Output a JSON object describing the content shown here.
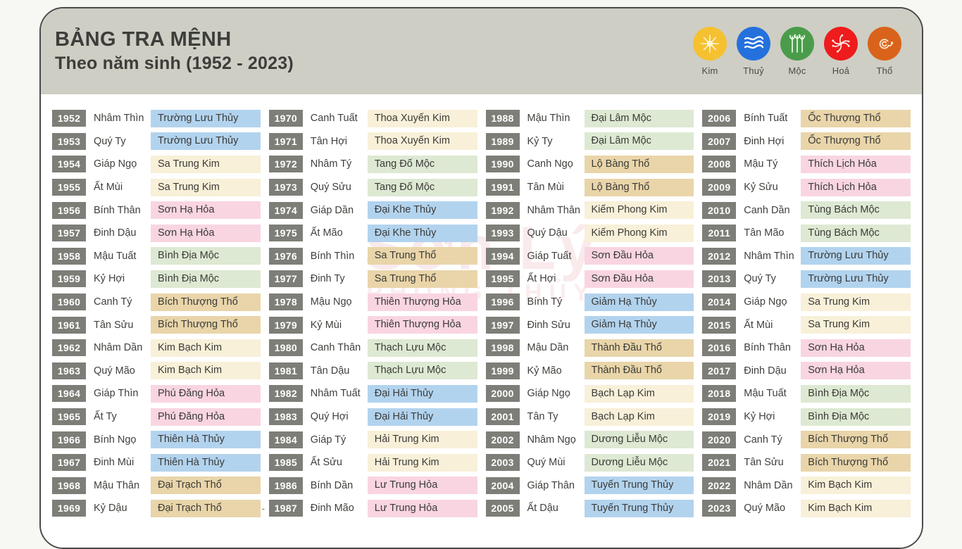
{
  "header": {
    "title_line1": "BẢNG TRA MỆNH",
    "title_line2": "Theo năm sinh (1952 - 2023)"
  },
  "legend": {
    "items": [
      {
        "label": "Kim",
        "icon": "metal-sparkle-icon",
        "color": "#f5c130"
      },
      {
        "label": "Thuỷ",
        "icon": "water-waves-icon",
        "color": "#2471dd"
      },
      {
        "label": "Mộc",
        "icon": "wood-sprout-icon",
        "color": "#4a9c4a"
      },
      {
        "label": "Hoả",
        "icon": "fire-burst-icon",
        "color": "#ee1c1c"
      },
      {
        "label": "Thổ",
        "icon": "earth-swirl-icon",
        "color": "#d9631a"
      }
    ]
  },
  "element_colors": {
    "kim": "#f8f0d8",
    "thuy": "#b2d3ee",
    "moc": "#dde9d2",
    "hoa": "#f9d5e1",
    "tho": "#e9d5a9"
  },
  "watermark": {
    "main": "Sơn Lý",
    "sub": "PHONG THỦY"
  },
  "columns": [
    {
      "rows": [
        {
          "year": "1952",
          "can_chi": "Nhâm Thìn",
          "menh": "Trường Lưu Thủy",
          "element": "thuy"
        },
        {
          "year": "1953",
          "can_chi": "Quý Ty",
          "menh": "Trường Lưu Thủy",
          "element": "thuy"
        },
        {
          "year": "1954",
          "can_chi": "Giáp Ngọ",
          "menh": "Sa Trung Kim",
          "element": "kim"
        },
        {
          "year": "1955",
          "can_chi": "Ất Mùi",
          "menh": "Sa Trung Kim",
          "element": "kim"
        },
        {
          "year": "1956",
          "can_chi": "Bính Thân",
          "menh": "Sơn Hạ Hỏa",
          "element": "hoa"
        },
        {
          "year": "1957",
          "can_chi": "Đinh Dậu",
          "menh": "Sơn Hạ Hỏa",
          "element": "hoa"
        },
        {
          "year": "1958",
          "can_chi": "Mậu Tuất",
          "menh": "Bình Địa Mộc",
          "element": "moc"
        },
        {
          "year": "1959",
          "can_chi": "Kỷ Hợi",
          "menh": "Bình Địa Mộc",
          "element": "moc"
        },
        {
          "year": "1960",
          "can_chi": "Canh Tý",
          "menh": "Bích Thượng Thổ",
          "element": "tho"
        },
        {
          "year": "1961",
          "can_chi": "Tân Sửu",
          "menh": "Bích Thượng Thổ",
          "element": "tho"
        },
        {
          "year": "1962",
          "can_chi": "Nhâm Dần",
          "menh": "Kim Bạch Kim",
          "element": "kim"
        },
        {
          "year": "1963",
          "can_chi": "Quý Mão",
          "menh": "Kim Bạch Kim",
          "element": "kim"
        },
        {
          "year": "1964",
          "can_chi": "Giáp Thìn",
          "menh": "Phú Đăng Hỏa",
          "element": "hoa"
        },
        {
          "year": "1965",
          "can_chi": "Ất Ty",
          "menh": "Phú Đăng Hỏa",
          "element": "hoa"
        },
        {
          "year": "1966",
          "can_chi": "Bính Ngọ",
          "menh": "Thiên Hà Thủy",
          "element": "thuy"
        },
        {
          "year": "1967",
          "can_chi": "Đinh Mùi",
          "menh": "Thiên Hà Thủy",
          "element": "thuy"
        },
        {
          "year": "1968",
          "can_chi": "Mậu Thân",
          "menh": "Đại Trạch Thổ",
          "element": "tho"
        },
        {
          "year": "1969",
          "can_chi": "Kỷ Dậu",
          "menh": "Đại Trạch Thổ",
          "element": "tho"
        }
      ]
    },
    {
      "rows": [
        {
          "year": "1970",
          "can_chi": "Canh Tuất",
          "menh": "Thoa Xuyến Kim",
          "element": "kim"
        },
        {
          "year": "1971",
          "can_chi": "Tân Hợi",
          "menh": "Thoa Xuyến Kim",
          "element": "kim"
        },
        {
          "year": "1972",
          "can_chi": "Nhâm Tý",
          "menh": "Tang Đố Mộc",
          "element": "moc"
        },
        {
          "year": "1973",
          "can_chi": "Quý Sửu",
          "menh": "Tang Đố Mộc",
          "element": "moc"
        },
        {
          "year": "1974",
          "can_chi": "Giáp Dần",
          "menh": "Đại Khe Thủy",
          "element": "thuy"
        },
        {
          "year": "1975",
          "can_chi": "Ất Mão",
          "menh": "Đại Khe Thủy",
          "element": "thuy"
        },
        {
          "year": "1976",
          "can_chi": "Bính Thìn",
          "menh": "Sa Trung Thổ",
          "element": "tho"
        },
        {
          "year": "1977",
          "can_chi": "Đinh Ty",
          "menh": "Sa Trung Thổ",
          "element": "tho"
        },
        {
          "year": "1978",
          "can_chi": "Mậu Ngọ",
          "menh": "Thiên Thượng Hỏa",
          "element": "hoa"
        },
        {
          "year": "1979",
          "can_chi": "Kỷ Mùi",
          "menh": "Thiên Thượng Hỏa",
          "element": "hoa"
        },
        {
          "year": "1980",
          "can_chi": "Canh Thân",
          "menh": "Thạch Lựu Mộc",
          "element": "moc"
        },
        {
          "year": "1981",
          "can_chi": "Tân Dậu",
          "menh": "Thạch Lựu Mộc",
          "element": "moc"
        },
        {
          "year": "1982",
          "can_chi": "Nhâm Tuất",
          "menh": "Đại Hải Thủy",
          "element": "thuy"
        },
        {
          "year": "1983",
          "can_chi": "Quý Hợi",
          "menh": "Đại Hải Thủy",
          "element": "thuy"
        },
        {
          "year": "1984",
          "can_chi": "Giáp Tý",
          "menh": "Hải Trung Kim",
          "element": "kim"
        },
        {
          "year": "1985",
          "can_chi": "Ất Sửu",
          "menh": "Hải Trung Kim",
          "element": "kim"
        },
        {
          "year": "1986",
          "can_chi": "Bính Dần",
          "menh": "Lư Trung Hỏa",
          "element": "hoa"
        },
        {
          "year": "1987",
          "can_chi": "Đinh Mão",
          "menh": "Lư Trung Hỏa",
          "element": "hoa"
        }
      ]
    },
    {
      "rows": [
        {
          "year": "1988",
          "can_chi": "Mậu Thìn",
          "menh": "Đại Lâm Mộc",
          "element": "moc"
        },
        {
          "year": "1989",
          "can_chi": "Kỷ Ty",
          "menh": "Đại Lâm Mộc",
          "element": "moc"
        },
        {
          "year": "1990",
          "can_chi": "Canh Ngọ",
          "menh": "Lộ Bàng Thổ",
          "element": "tho"
        },
        {
          "year": "1991",
          "can_chi": "Tân Mùi",
          "menh": "Lộ Bàng Thổ",
          "element": "tho"
        },
        {
          "year": "1992",
          "can_chi": "Nhâm Thân",
          "menh": "Kiếm Phong Kim",
          "element": "kim"
        },
        {
          "year": "1993",
          "can_chi": "Quý Dậu",
          "menh": "Kiếm Phong Kim",
          "element": "kim"
        },
        {
          "year": "1994",
          "can_chi": "Giáp Tuất",
          "menh": "Sơn Đầu Hỏa",
          "element": "hoa"
        },
        {
          "year": "1995",
          "can_chi": "Ất Hợi",
          "menh": "Sơn Đầu Hỏa",
          "element": "hoa"
        },
        {
          "year": "1996",
          "can_chi": "Bính Tý",
          "menh": "Giảm Hạ Thủy",
          "element": "thuy"
        },
        {
          "year": "1997",
          "can_chi": "Đinh Sửu",
          "menh": "Giảm Hạ Thủy",
          "element": "thuy"
        },
        {
          "year": "1998",
          "can_chi": "Mậu Dần",
          "menh": "Thành Đầu Thổ",
          "element": "tho"
        },
        {
          "year": "1999",
          "can_chi": "Kỷ Mão",
          "menh": "Thành Đầu Thổ",
          "element": "tho"
        },
        {
          "year": "2000",
          "can_chi": "Giáp Ngọ",
          "menh": "Bạch Lạp Kim",
          "element": "kim"
        },
        {
          "year": "2001",
          "can_chi": "Tân Ty",
          "menh": "Bạch Lạp Kim",
          "element": "kim"
        },
        {
          "year": "2002",
          "can_chi": "Nhâm Ngọ",
          "menh": "Dương Liễu Mộc",
          "element": "moc"
        },
        {
          "year": "2003",
          "can_chi": "Quý Mùi",
          "menh": "Dương Liễu Mộc",
          "element": "moc"
        },
        {
          "year": "2004",
          "can_chi": "Giáp Thân",
          "menh": "Tuyến Trung Thủy",
          "element": "thuy"
        },
        {
          "year": "2005",
          "can_chi": "Ất Dậu",
          "menh": "Tuyến Trung Thủy",
          "element": "thuy"
        }
      ]
    },
    {
      "rows": [
        {
          "year": "2006",
          "can_chi": "Bính Tuất",
          "menh": "Ốc Thượng Thổ",
          "element": "tho"
        },
        {
          "year": "2007",
          "can_chi": "Đinh Hợi",
          "menh": "Ốc Thượng Thổ",
          "element": "tho"
        },
        {
          "year": "2008",
          "can_chi": "Mậu Tý",
          "menh": "Thích Lịch Hỏa",
          "element": "hoa"
        },
        {
          "year": "2009",
          "can_chi": "Kỷ Sửu",
          "menh": "Thích Lịch Hỏa",
          "element": "hoa"
        },
        {
          "year": "2010",
          "can_chi": "Canh Dần",
          "menh": "Tùng Bách Mộc",
          "element": "moc"
        },
        {
          "year": "2011",
          "can_chi": "Tân Mão",
          "menh": "Tùng Bách Mộc",
          "element": "moc"
        },
        {
          "year": "2012",
          "can_chi": "Nhâm Thìn",
          "menh": "Trường Lưu Thủy",
          "element": "thuy"
        },
        {
          "year": "2013",
          "can_chi": "Quý Ty",
          "menh": "Trường Lưu Thủy",
          "element": "thuy"
        },
        {
          "year": "2014",
          "can_chi": "Giáp Ngọ",
          "menh": "Sa Trung Kim",
          "element": "kim"
        },
        {
          "year": "2015",
          "can_chi": "Ất Mùi",
          "menh": "Sa Trung Kim",
          "element": "kim"
        },
        {
          "year": "2016",
          "can_chi": "Bính Thân",
          "menh": "Sơn Hạ Hỏa",
          "element": "hoa"
        },
        {
          "year": "2017",
          "can_chi": "Đinh Dậu",
          "menh": "Sơn Hạ Hỏa",
          "element": "hoa"
        },
        {
          "year": "2018",
          "can_chi": "Mậu Tuất",
          "menh": "Bình Địa Mộc",
          "element": "moc"
        },
        {
          "year": "2019",
          "can_chi": "Kỷ Hợi",
          "menh": "Bình Địa Mộc",
          "element": "moc"
        },
        {
          "year": "2020",
          "can_chi": "Canh Tý",
          "menh": "Bích Thượng Thổ",
          "element": "tho"
        },
        {
          "year": "2021",
          "can_chi": "Tân Sửu",
          "menh": "Bích Thượng Thổ",
          "element": "tho"
        },
        {
          "year": "2022",
          "can_chi": "Nhâm Dần",
          "menh": "Kim Bạch Kim",
          "element": "kim"
        },
        {
          "year": "2023",
          "can_chi": "Quý Mão",
          "menh": "Kim Bạch Kim",
          "element": "kim"
        }
      ]
    }
  ]
}
